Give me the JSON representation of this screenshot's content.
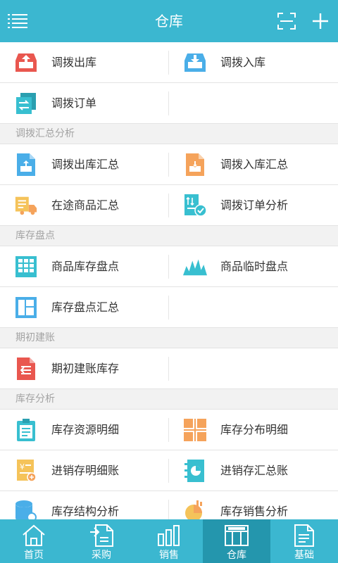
{
  "header": {
    "title": "仓库",
    "menu_icon": "menu-icon",
    "scan_icon": "scan-icon",
    "add_icon": "plus-icon"
  },
  "colors": {
    "primary": "#3bb7d0",
    "active_tab": "#2496ad",
    "red": "#e9574f",
    "blue": "#4aaee8",
    "orange": "#f5a35b",
    "yellow": "#f5c35a",
    "teal": "#38bfd0"
  },
  "groups": [
    {
      "title": "",
      "items": [
        {
          "label": "调拨出库",
          "icon": "transfer-out-icon"
        },
        {
          "label": "调拨入库",
          "icon": "transfer-in-icon"
        },
        {
          "label": "调拨订单",
          "icon": "transfer-order-icon"
        }
      ]
    },
    {
      "title": "调拨汇总分析",
      "items": [
        {
          "label": "调拨出库汇总",
          "icon": "transfer-out-summary-icon"
        },
        {
          "label": "调拨入库汇总",
          "icon": "transfer-in-summary-icon"
        },
        {
          "label": "在途商品汇总",
          "icon": "in-transit-icon"
        },
        {
          "label": "调拨订单分析",
          "icon": "order-analysis-icon"
        }
      ]
    },
    {
      "title": "库存盘点",
      "items": [
        {
          "label": "商品库存盘点",
          "icon": "stock-count-icon"
        },
        {
          "label": "商品临时盘点",
          "icon": "temp-count-icon"
        },
        {
          "label": "库存盘点汇总",
          "icon": "count-summary-icon"
        }
      ]
    },
    {
      "title": "期初建账",
      "items": [
        {
          "label": "期初建账库存",
          "icon": "opening-stock-icon"
        }
      ]
    },
    {
      "title": "库存分析",
      "items": [
        {
          "label": "库存资源明细",
          "icon": "resource-detail-icon"
        },
        {
          "label": "库存分布明细",
          "icon": "distribution-icon"
        },
        {
          "label": "进销存明细账",
          "icon": "ledger-detail-icon"
        },
        {
          "label": "进销存汇总账",
          "icon": "ledger-summary-icon"
        },
        {
          "label": "库存结构分析",
          "icon": "structure-analysis-icon"
        },
        {
          "label": "库存销售分析",
          "icon": "sales-analysis-icon"
        }
      ]
    }
  ],
  "tabs": [
    {
      "label": "首页",
      "icon": "home-icon",
      "active": false
    },
    {
      "label": "采购",
      "icon": "purchase-icon",
      "active": false
    },
    {
      "label": "销售",
      "icon": "sales-icon",
      "active": false
    },
    {
      "label": "仓库",
      "icon": "warehouse-icon",
      "active": true
    },
    {
      "label": "基础",
      "icon": "basic-icon",
      "active": false
    }
  ]
}
